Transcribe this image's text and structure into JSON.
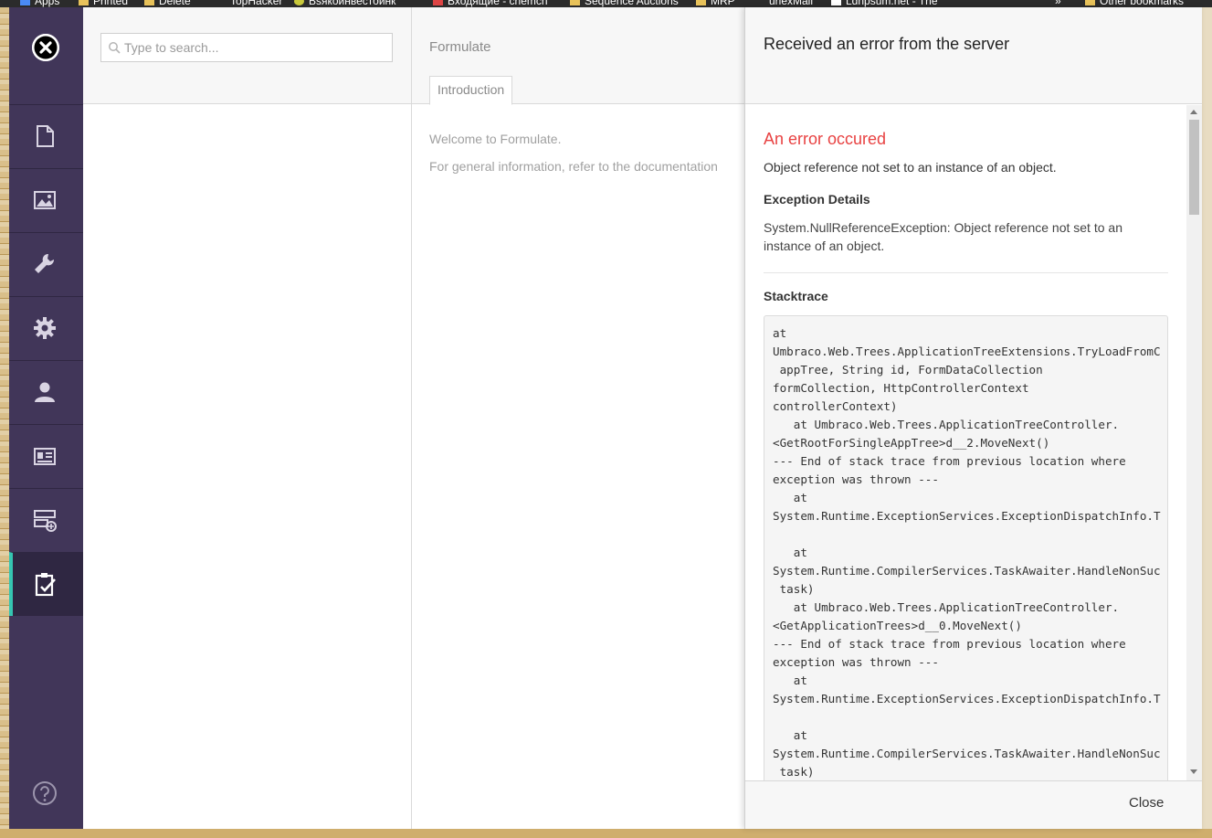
{
  "browser": {
    "bookmarks": [
      "Apps",
      "Printed",
      "Delete",
      "TopHacker",
      "Вsякоинвестоинк",
      "Входящие - chemch",
      "Sequence Auctions",
      "MRP",
      "urlexMail",
      "Ldnpsum.net - The",
      "»",
      "Other bookmarks"
    ]
  },
  "sidebar": {
    "close_icon": "close-icon",
    "items": [
      {
        "name": "content",
        "icon": "document-icon",
        "active": false
      },
      {
        "name": "media",
        "icon": "image-icon",
        "active": false
      },
      {
        "name": "developer",
        "icon": "wrench-icon",
        "active": false
      },
      {
        "name": "settings",
        "icon": "gear-icon",
        "active": false
      },
      {
        "name": "users",
        "icon": "user-icon",
        "active": false
      },
      {
        "name": "members",
        "icon": "id-card-icon",
        "active": false
      },
      {
        "name": "forms",
        "icon": "form-add-icon",
        "active": false
      },
      {
        "name": "formulate",
        "icon": "clipboard-check-icon",
        "active": true
      }
    ],
    "help_icon": "help-icon",
    "colors": {
      "background": "#413659",
      "active_accent": "#35c5b1"
    }
  },
  "tree": {
    "search_placeholder": "Type to search..."
  },
  "main": {
    "title": "Formulate",
    "tabs": [
      {
        "label": "Introduction",
        "active": true
      }
    ],
    "paragraphs": [
      "Welcome to Formulate.",
      "For general information, refer to the documentation"
    ]
  },
  "dialog": {
    "title": "Received an error from the server",
    "error_heading": "An error occured",
    "error_message": "Object reference not set to an instance of an object.",
    "exception_heading": "Exception Details",
    "exception_details": "System.NullReferenceException: Object reference not set to an instance of an object.",
    "stacktrace_heading": "Stacktrace",
    "stacktrace": "at\nUmbraco.Web.Trees.ApplicationTreeExtensions.TryLoadFromC\n appTree, String id, FormDataCollection\nformCollection, HttpControllerContext\ncontrollerContext)\n   at Umbraco.Web.Trees.ApplicationTreeController.\n<GetRootForSingleAppTree>d__2.MoveNext()\n--- End of stack trace from previous location where\nexception was thrown ---\n   at\nSystem.Runtime.ExceptionServices.ExceptionDispatchInfo.T\n\n   at\nSystem.Runtime.CompilerServices.TaskAwaiter.HandleNonSuc\n task)\n   at Umbraco.Web.Trees.ApplicationTreeController.\n<GetApplicationTrees>d__0.MoveNext()\n--- End of stack trace from previous location where\nexception was thrown ---\n   at\nSystem.Runtime.ExceptionServices.ExceptionDispatchInfo.T\n\n   at\nSystem.Runtime.CompilerServices.TaskAwaiter.HandleNonSuc\n task)",
    "close_label": "Close",
    "colors": {
      "error": "#e84242"
    }
  }
}
